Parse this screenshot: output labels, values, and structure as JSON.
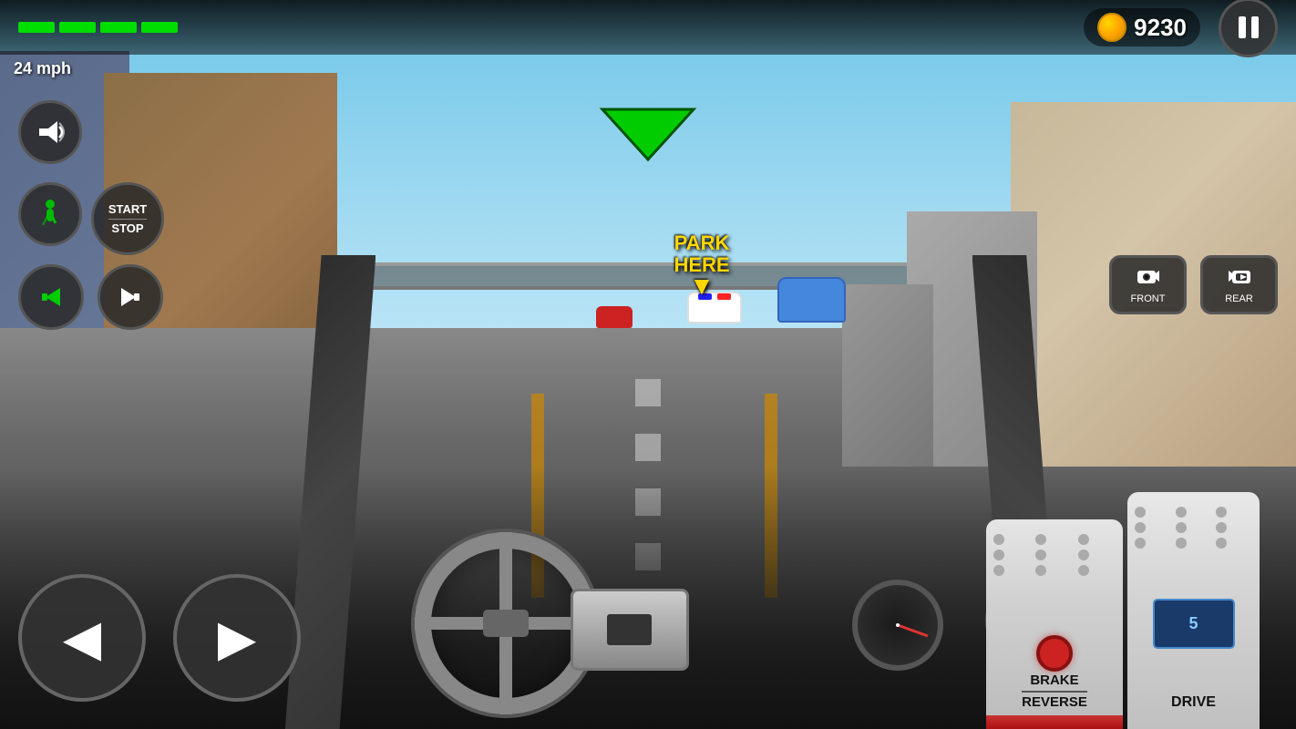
{
  "hud": {
    "speed": "24 mph",
    "score": "9230",
    "health_bars": 4,
    "pause_label": "⏸"
  },
  "nav": {
    "arrow_indicator": "▼",
    "park_here_line1": "PARK",
    "park_here_line2": "HERE"
  },
  "left_controls": {
    "horn_icon": "📯",
    "seatbelt_icon": "🧍",
    "start_stop_label1": "START",
    "start_stop_label2": "STOP",
    "turn_left_label": "L",
    "turn_right_label": "R"
  },
  "steering": {
    "left_label": "◀",
    "right_label": "▶"
  },
  "camera": {
    "front_label": "FRONT",
    "rear_label": "REAR",
    "front_icon": "📹",
    "rear_icon": "⏩"
  },
  "pedals": {
    "brake_label": "BRAKE",
    "reverse_label": "REVERSE",
    "drive_label": "DRIVE"
  },
  "colors": {
    "green_bar": "#00dd00",
    "gold": "#FFD700",
    "nav_arrow": "#00cc00",
    "park_text": "#FFD700"
  }
}
